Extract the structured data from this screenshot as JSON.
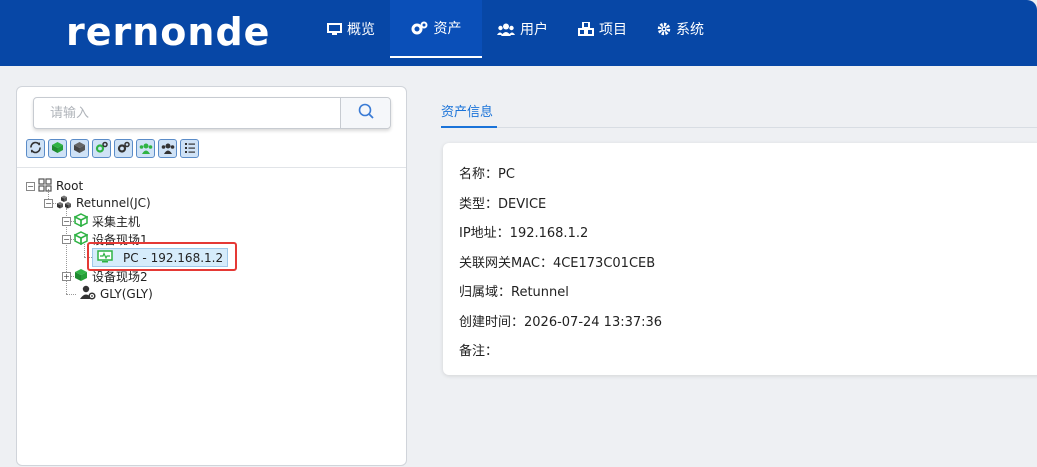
{
  "header": {
    "logo": "rernonde",
    "nav": [
      {
        "label": "概览",
        "icon": "monitor-icon"
      },
      {
        "label": "资产",
        "icon": "gears-icon"
      },
      {
        "label": "用户",
        "icon": "users-icon"
      },
      {
        "label": "项目",
        "icon": "cubes-icon"
      },
      {
        "label": "系统",
        "icon": "gear-icon"
      }
    ],
    "active_nav": "资产"
  },
  "search": {
    "placeholder": "请输入",
    "value": ""
  },
  "tree": {
    "root": "Root",
    "domain": "Retunnel(JC)",
    "collector": "采集主机",
    "site1": "设备现场1",
    "pc": "PC - 192.168.1.2",
    "site2": "设备现场2",
    "user": "GLY(GLY)"
  },
  "tabs": {
    "active": "资产信息"
  },
  "info": {
    "name": "名称：PC",
    "type": "类型：DEVICE",
    "ip": "IP地址：192.168.1.2",
    "mac": "关联网关MAC：4CE173C01CEB",
    "domain": "归属域：Retunnel",
    "created": "创建时间：2026-07-24 13:37:36",
    "remark": "备注："
  },
  "colors": {
    "header_bg": "#0747a6",
    "accent": "#1a73d9",
    "highlight": "#e53935",
    "device_green": "#2fb344"
  }
}
